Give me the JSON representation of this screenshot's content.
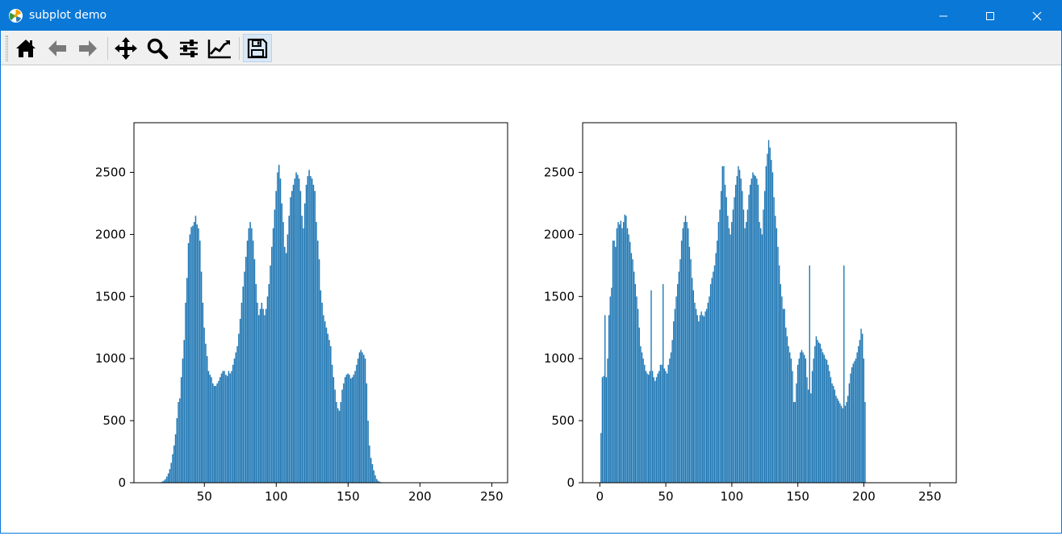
{
  "window": {
    "title": "subplot demo",
    "controls": [
      "minimize",
      "maximize",
      "close"
    ]
  },
  "toolbar": {
    "tools": [
      {
        "name": "home-button",
        "icon": "home-icon",
        "label": "Home"
      },
      {
        "name": "back-button",
        "icon": "arrow-left-icon",
        "label": "Back"
      },
      {
        "name": "forward-button",
        "icon": "arrow-right-icon",
        "label": "Forward"
      },
      {
        "name": "pan-button",
        "icon": "move-icon",
        "label": "Pan"
      },
      {
        "name": "zoom-button",
        "icon": "magnifier-icon",
        "label": "Zoom"
      },
      {
        "name": "configure-subplots-button",
        "icon": "sliders-icon",
        "label": "Subplots"
      },
      {
        "name": "edit-axes-button",
        "icon": "line-chart-icon",
        "label": "Customize"
      },
      {
        "name": "save-button",
        "icon": "floppy-disk-icon",
        "label": "Save"
      }
    ]
  },
  "chart_data": [
    {
      "type": "bar",
      "bar_color": "#1f77b4",
      "xlim": [
        1,
        261
      ],
      "ylim": [
        0,
        2900
      ],
      "xticks": [
        "50",
        "100",
        "150",
        "200",
        "250"
      ],
      "yticks": [
        "0",
        "500",
        "1000",
        "1500",
        "2000",
        "2500"
      ],
      "grid": false,
      "bin_width": 1,
      "x_start": 20,
      "x": [
        20,
        21,
        22,
        23,
        24,
        25,
        26,
        27,
        28,
        29,
        30,
        31,
        32,
        33,
        34,
        35,
        36,
        37,
        38,
        39,
        40,
        41,
        42,
        43,
        44,
        45,
        46,
        47,
        48,
        49,
        50,
        51,
        52,
        53,
        54,
        55,
        56,
        57,
        58,
        59,
        60,
        61,
        62,
        63,
        64,
        65,
        66,
        67,
        68,
        69,
        70,
        71,
        72,
        73,
        74,
        75,
        76,
        77,
        78,
        79,
        80,
        81,
        82,
        83,
        84,
        85,
        86,
        87,
        88,
        89,
        90,
        91,
        92,
        93,
        94,
        95,
        96,
        97,
        98,
        99,
        100,
        101,
        102,
        103,
        104,
        105,
        106,
        107,
        108,
        109,
        110,
        111,
        112,
        113,
        114,
        115,
        116,
        117,
        118,
        119,
        120,
        121,
        122,
        123,
        124,
        125,
        126,
        127,
        128,
        129,
        130,
        131,
        132,
        133,
        134,
        135,
        136,
        137,
        138,
        139,
        140,
        141,
        142,
        143,
        144,
        145,
        146,
        147,
        148,
        149,
        150,
        151,
        152,
        153,
        154,
        155,
        156,
        157,
        158,
        159,
        160,
        161,
        162,
        163,
        164,
        165,
        166,
        167,
        168,
        169,
        170,
        171,
        172,
        173,
        174,
        175,
        176,
        177,
        178,
        179,
        180,
        181,
        182,
        183,
        184,
        185,
        186,
        187,
        188,
        189,
        190,
        191,
        192,
        193,
        194,
        195,
        196,
        197,
        198,
        199,
        200,
        201,
        202,
        203,
        204,
        205,
        206,
        207,
        208,
        209,
        210,
        211,
        212,
        213,
        214,
        215,
        216,
        217,
        218,
        219,
        220,
        221,
        222,
        223,
        224,
        225,
        226,
        227,
        228,
        229,
        230,
        231,
        232,
        233,
        234,
        235,
        236,
        237,
        238,
        239,
        240,
        241,
        242,
        243,
        244,
        245,
        246,
        247,
        248,
        249,
        250
      ],
      "values": [
        5,
        10,
        18,
        30,
        50,
        75,
        110,
        160,
        230,
        300,
        390,
        520,
        650,
        680,
        850,
        1000,
        1150,
        1450,
        1650,
        1930,
        2000,
        2060,
        2070,
        2100,
        2150,
        2080,
        2050,
        1950,
        1700,
        1450,
        1250,
        1120,
        1020,
        900,
        870,
        850,
        800,
        780,
        780,
        800,
        820,
        850,
        880,
        900,
        900,
        870,
        860,
        900,
        880,
        900,
        950,
        1000,
        1050,
        1100,
        1200,
        1320,
        1450,
        1580,
        1700,
        1820,
        1950,
        2050,
        2100,
        2050,
        1950,
        1800,
        1600,
        1450,
        1350,
        1400,
        1450,
        1400,
        1350,
        1400,
        1500,
        1600,
        1750,
        1900,
        2050,
        2200,
        2350,
        2500,
        2560,
        2450,
        2250,
        2100,
        1900,
        1850,
        2000,
        2150,
        2300,
        2350,
        2400,
        2450,
        2500,
        2480,
        2450,
        2350,
        2150,
        2050,
        2250,
        2400,
        2470,
        2520,
        2470,
        2450,
        2400,
        2350,
        2100,
        1950,
        1800,
        1550,
        1450,
        1350,
        1300,
        1250,
        1200,
        1150,
        1100,
        950,
        850,
        750,
        650,
        600,
        580,
        650,
        750,
        800,
        850,
        870,
        880,
        870,
        840,
        850,
        870,
        900,
        950,
        1000,
        1050,
        1070,
        1050,
        1030,
        1000,
        800,
        500,
        300,
        200,
        150,
        100,
        60,
        30,
        15,
        8,
        5,
        3,
        2,
        1,
        1,
        0,
        0,
        0,
        0,
        0,
        0,
        0,
        0,
        0,
        0,
        0,
        0,
        0,
        0,
        0,
        0,
        0,
        0,
        0,
        0,
        0,
        0,
        0,
        0,
        0,
        0,
        0,
        0,
        0,
        0,
        0,
        0,
        0,
        0,
        0,
        0,
        0,
        0,
        0,
        0,
        0,
        0,
        0,
        0,
        0,
        0,
        0,
        0,
        0,
        0,
        0,
        0,
        0,
        0,
        0,
        0,
        0,
        0,
        0,
        0,
        0,
        0,
        0,
        0,
        0,
        0,
        0,
        0,
        0,
        0,
        0,
        0,
        0,
        0,
        0,
        0,
        0,
        0,
        0,
        0
      ]
    },
    {
      "type": "bar",
      "bar_color": "#1f77b4",
      "xlim": [
        -13,
        270
      ],
      "ylim": [
        0,
        2900
      ],
      "xticks": [
        "0",
        "50",
        "100",
        "150",
        "200",
        "250"
      ],
      "yticks": [
        "0",
        "500",
        "1000",
        "1500",
        "2000",
        "2500"
      ],
      "grid": false,
      "bin_width": 1,
      "x_start": 0,
      "x": [
        0,
        1,
        2,
        3,
        4,
        5,
        6,
        7,
        8,
        9,
        10,
        11,
        12,
        13,
        14,
        15,
        16,
        17,
        18,
        19,
        20,
        21,
        22,
        23,
        24,
        25,
        26,
        27,
        28,
        29,
        30,
        31,
        32,
        33,
        34,
        35,
        36,
        37,
        38,
        39,
        40,
        41,
        42,
        43,
        44,
        45,
        46,
        47,
        48,
        49,
        50,
        51,
        52,
        53,
        54,
        55,
        56,
        57,
        58,
        59,
        60,
        61,
        62,
        63,
        64,
        65,
        66,
        67,
        68,
        69,
        70,
        71,
        72,
        73,
        74,
        75,
        76,
        77,
        78,
        79,
        80,
        81,
        82,
        83,
        84,
        85,
        86,
        87,
        88,
        89,
        90,
        91,
        92,
        93,
        94,
        95,
        96,
        97,
        98,
        99,
        100,
        101,
        102,
        103,
        104,
        105,
        106,
        107,
        108,
        109,
        110,
        111,
        112,
        113,
        114,
        115,
        116,
        117,
        118,
        119,
        120,
        121,
        122,
        123,
        124,
        125,
        126,
        127,
        128,
        129,
        130,
        131,
        132,
        133,
        134,
        135,
        136,
        137,
        138,
        139,
        140,
        141,
        142,
        143,
        144,
        145,
        146,
        147,
        148,
        149,
        150,
        151,
        152,
        153,
        154,
        155,
        156,
        157,
        158,
        159,
        160,
        161,
        162,
        163,
        164,
        165,
        166,
        167,
        168,
        169,
        170,
        171,
        172,
        173,
        174,
        175,
        176,
        177,
        178,
        179,
        180,
        181,
        182,
        183,
        184,
        185,
        186,
        187,
        188,
        189,
        190,
        191,
        192,
        193,
        194,
        195,
        196,
        197,
        198,
        199,
        200,
        201,
        202,
        203,
        204,
        205,
        206,
        207,
        208,
        209,
        210,
        211,
        212,
        213,
        214,
        215,
        216,
        217,
        218,
        219,
        220,
        221,
        222,
        223,
        224,
        225,
        226,
        227,
        228,
        229,
        230,
        231,
        232,
        233,
        234,
        235,
        236,
        237,
        238,
        239,
        240,
        241,
        242,
        243,
        244,
        245,
        246,
        247,
        248,
        249,
        250,
        251,
        252,
        253,
        254,
        255
      ],
      "values": [
        0,
        400,
        850,
        860,
        1350,
        850,
        1000,
        1350,
        1500,
        1570,
        1950,
        1950,
        1900,
        2050,
        2100,
        2080,
        2110,
        2050,
        2100,
        2160,
        2150,
        2050,
        2000,
        1940,
        1850,
        1800,
        1700,
        1600,
        1500,
        1400,
        1250,
        1100,
        1050,
        1000,
        950,
        900,
        880,
        870,
        900,
        1550,
        900,
        850,
        820,
        850,
        880,
        900,
        950,
        950,
        1600,
        920,
        900,
        880,
        950,
        1000,
        1050,
        1150,
        1300,
        1400,
        1500,
        1600,
        1700,
        1800,
        1950,
        2050,
        2100,
        2150,
        2100,
        2050,
        1900,
        1800,
        1650,
        1550,
        1450,
        1400,
        1350,
        1300,
        1350,
        1380,
        1350,
        1340,
        1380,
        1400,
        1450,
        1500,
        1600,
        1650,
        1700,
        1750,
        1850,
        1950,
        2100,
        2200,
        2350,
        2550,
        2550,
        2400,
        2300,
        2150,
        2050,
        2000,
        2100,
        2200,
        2300,
        2400,
        2470,
        2550,
        2520,
        2450,
        2350,
        2200,
        2050,
        2100,
        2200,
        2320,
        2400,
        2450,
        2500,
        2480,
        2470,
        2450,
        2400,
        2100,
        2050,
        2000,
        2200,
        2350,
        2550,
        2650,
        2760,
        2700,
        2600,
        2500,
        2300,
        2150,
        2050,
        1900,
        1750,
        1600,
        1500,
        1400,
        1400,
        1250,
        1180,
        1100,
        1050,
        1000,
        900,
        650,
        650,
        800,
        950,
        1000,
        1050,
        1070,
        1050,
        1030,
        1000,
        850,
        750,
        1750,
        720,
        900,
        1000,
        1100,
        1180,
        1150,
        1130,
        1120,
        1080,
        1050,
        1030,
        1000,
        990,
        950,
        900,
        850,
        800,
        780,
        750,
        700,
        680,
        660,
        640,
        620,
        600,
        1750,
        620,
        650,
        700,
        800,
        880,
        930,
        960,
        980,
        1000,
        1050,
        1100,
        1150,
        1240,
        1200,
        1000,
        650,
        0,
        0,
        0,
        0,
        0,
        0,
        0,
        0,
        0,
        0,
        0,
        0,
        0,
        0,
        0,
        0,
        0,
        0,
        0,
        0,
        0,
        0,
        0,
        0,
        0,
        0,
        0,
        0,
        0,
        0,
        0,
        0,
        0,
        0,
        0,
        0,
        0,
        0,
        0,
        0,
        0,
        0,
        0,
        0,
        0,
        0,
        0,
        0,
        0,
        0
      ]
    }
  ]
}
